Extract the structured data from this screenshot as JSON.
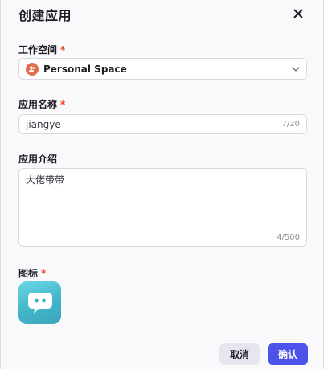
{
  "dialog": {
    "title": "创建应用",
    "close_icon": "close-icon"
  },
  "workspace": {
    "label": "工作空间",
    "required_mark": "*",
    "value": "Personal Space",
    "icon": "people-icon",
    "icon_color": "#e0704f"
  },
  "app_name": {
    "label": "应用名称",
    "required_mark": "*",
    "value": "jiangye",
    "counter": "7/20"
  },
  "app_intro": {
    "label": "应用介绍",
    "value": "大佬带带",
    "counter": "4/500"
  },
  "icon_field": {
    "label": "图标",
    "required_mark": "*",
    "icon": "chat-bubble-icon"
  },
  "footer": {
    "cancel_label": "取消",
    "confirm_label": "确认",
    "confirm_color": "#4d53e8"
  }
}
